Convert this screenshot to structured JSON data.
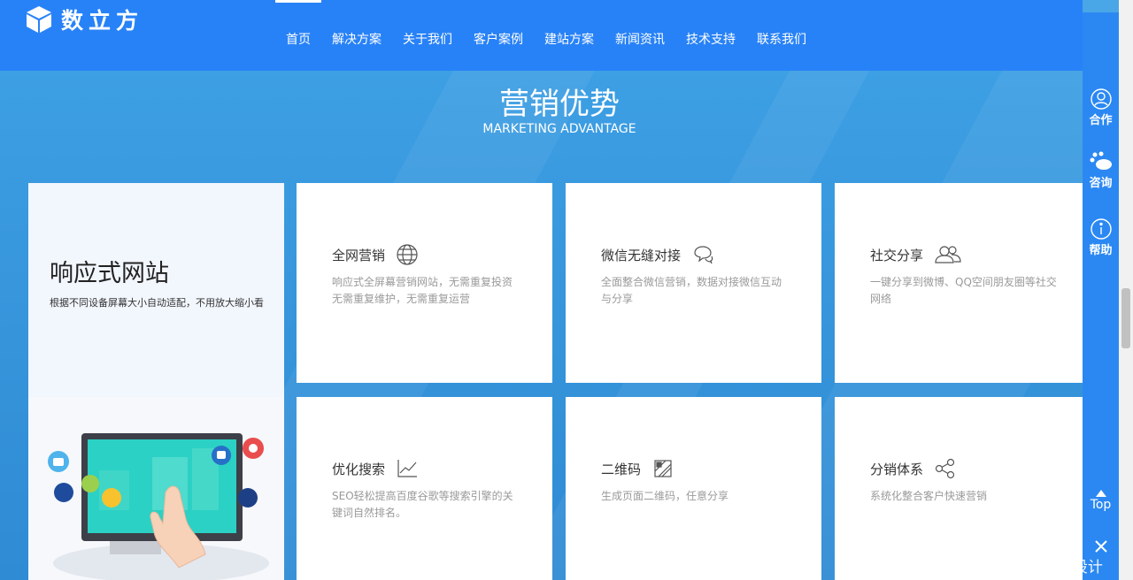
{
  "header": {
    "logo_text": "数立方",
    "nav": [
      {
        "label": "首页",
        "active": true
      },
      {
        "label": "解决方案"
      },
      {
        "label": "关于我们"
      },
      {
        "label": "客户案例"
      },
      {
        "label": "建站方案"
      },
      {
        "label": "新闻资讯"
      },
      {
        "label": "技术支持"
      },
      {
        "label": "联系我们"
      }
    ]
  },
  "section": {
    "title": "营销优势",
    "subtitle": "MARKETING ADVANTAGE"
  },
  "feature": {
    "title": "响应式网站",
    "desc": "根据不同设备屏幕大小自动适配，不用放大缩小看"
  },
  "cards": [
    {
      "title": "全网营销",
      "icon": "globe-icon",
      "desc": "响应式全屏幕营销网站，无需重复投资无需重复维护，无需重复运营"
    },
    {
      "title": "微信无缝对接",
      "icon": "chat-icon",
      "desc": "全面整合微信营销，数据对接微信互动与分享"
    },
    {
      "title": "社交分享",
      "icon": "users-icon",
      "desc": "一键分享到微博、QQ空间朋友圈等社交网络"
    },
    {
      "title": "优化搜索",
      "icon": "chart-icon",
      "desc": "SEO轻松提高百度谷歌等搜索引擎的关键词自然排名。"
    },
    {
      "title": "二维码",
      "icon": "qrcode-icon",
      "desc": "生成页面二维码，任意分享"
    },
    {
      "title": "分销体系",
      "icon": "share-icon",
      "desc": "系统化整合客户快速营销"
    }
  ],
  "sidebar": {
    "cooperate": "合作",
    "consult": "咨询",
    "help": "帮助",
    "top": "Top"
  },
  "watermark": "CSDN @仙女网页设计",
  "colors": {
    "header": "#2882f7",
    "sidebar": "#2b88f2",
    "background": "#3a9ae0"
  }
}
